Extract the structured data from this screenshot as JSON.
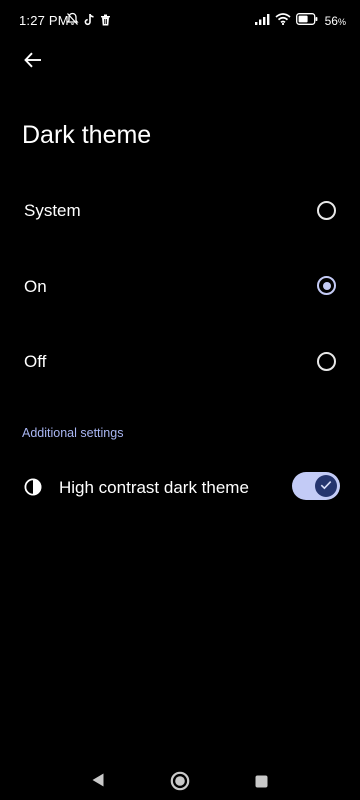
{
  "status_bar": {
    "time": "1:27 PM",
    "battery_percent": "56",
    "battery_suffix": "%",
    "left_icons": [
      "notifications-off-icon",
      "tiktok-icon",
      "trash-icon"
    ],
    "right_icons": [
      "signal-icon",
      "wifi-icon",
      "battery-icon"
    ]
  },
  "header": {
    "back_icon": "arrow-left-icon",
    "title": "Dark theme"
  },
  "options": [
    {
      "label": "System",
      "selected": false
    },
    {
      "label": "On",
      "selected": true
    },
    {
      "label": "Off",
      "selected": false
    }
  ],
  "additional": {
    "section_title": "Additional settings",
    "high_contrast": {
      "label": "High contrast dark theme",
      "icon": "contrast-icon",
      "enabled": true
    }
  },
  "nav_bar": {
    "icons": [
      "nav-back-icon",
      "nav-home-icon",
      "nav-recents-icon"
    ]
  },
  "colors": {
    "background": "#000000",
    "accent": "#c4cbf5",
    "section_header": "#a9b6f2",
    "toggle_thumb": "#25356e"
  }
}
